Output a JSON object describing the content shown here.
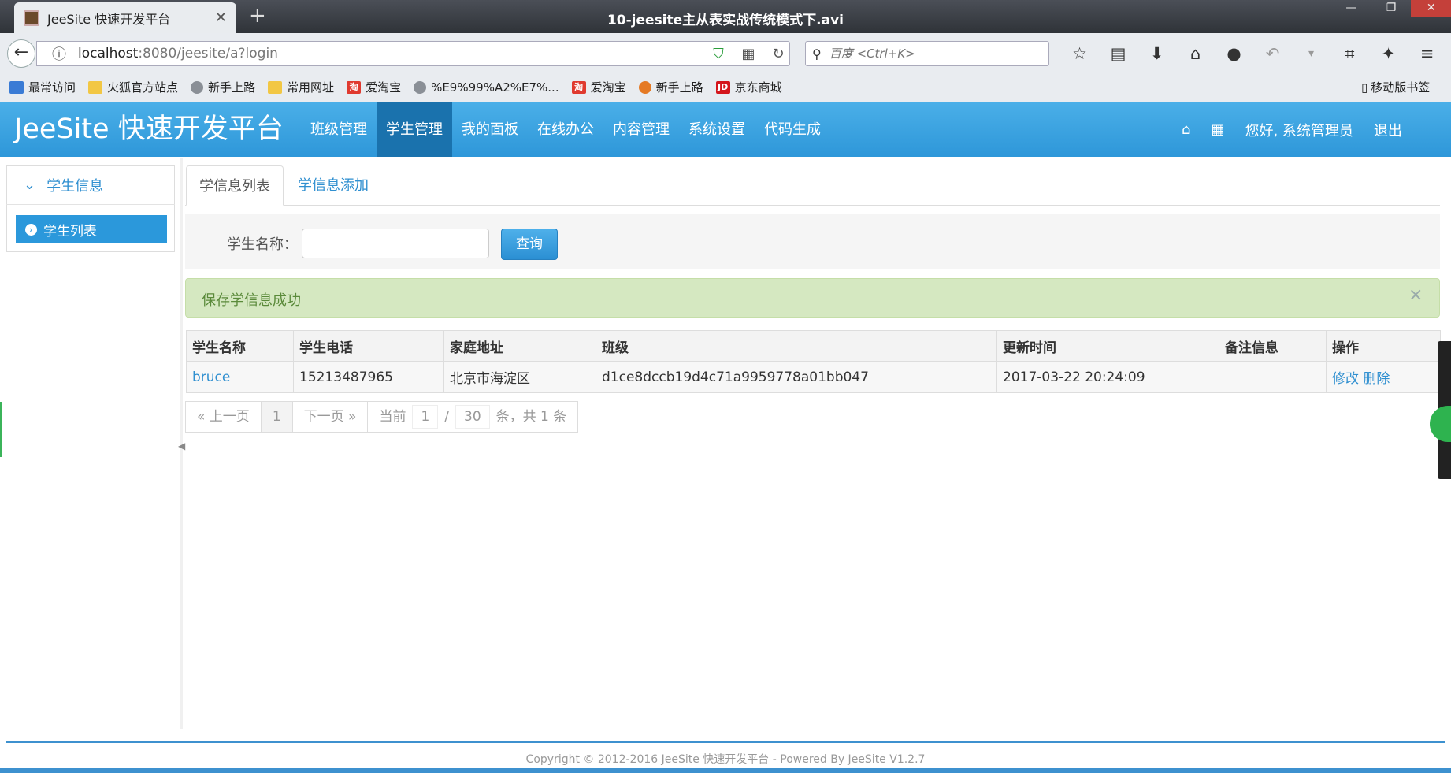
{
  "browser": {
    "tab_title": "JeeSite 快速开发平台",
    "tab_close": "✕",
    "new_tab": "+",
    "video_title": "10-jeesite主从表实战传统模式下.avi",
    "url_host": "localhost",
    "url_path": ":8080/jeesite/a?login",
    "search_placeholder": "百度 <Ctrl+K>",
    "win_min": "—",
    "win_restore": "❐",
    "win_close": "✕"
  },
  "bookmarks": {
    "items": [
      {
        "label": "最常访问",
        "icon": "most-visited-icon"
      },
      {
        "label": "火狐官方站点",
        "icon": "folder-icon"
      },
      {
        "label": "新手上路",
        "icon": "globe-icon"
      },
      {
        "label": "常用网址",
        "icon": "folder-icon"
      },
      {
        "label": "爱淘宝",
        "icon": "taobao-icon"
      },
      {
        "label": "%E9%99%A2%E7%...",
        "icon": "globe-icon"
      },
      {
        "label": "爱淘宝",
        "icon": "taobao-icon"
      },
      {
        "label": "新手上路",
        "icon": "firefox-icon"
      },
      {
        "label": "京东商城",
        "icon": "jd-icon"
      }
    ],
    "mobile": "移动版书签"
  },
  "app": {
    "brand": "JeeSite 快速开发平台",
    "nav": [
      "班级管理",
      "学生管理",
      "我的面板",
      "在线办公",
      "内容管理",
      "系统设置",
      "代码生成"
    ],
    "active_nav": "学生管理",
    "greeting": "您好, 系统管理员",
    "logout": "退出"
  },
  "sidebar": {
    "section": "学生信息",
    "items": [
      {
        "label": "学生列表",
        "active": true
      }
    ]
  },
  "tabs": {
    "list": "学信息列表",
    "add": "学信息添加"
  },
  "search": {
    "label": "学生名称：",
    "value": "",
    "button": "查询"
  },
  "alert": {
    "text": "保存学信息成功",
    "close": "×"
  },
  "table": {
    "headers": [
      "学生名称",
      "学生电话",
      "家庭地址",
      "班级",
      "更新时间",
      "备注信息",
      "操作"
    ],
    "rows": [
      {
        "name": "bruce",
        "phone": "15213487965",
        "address": "北京市海淀区",
        "class": "d1ce8dccb19d4c71a9959778a01bb047",
        "updated": "2017-03-22 20:24:09",
        "remarks": "",
        "edit": "修改",
        "delete": "删除"
      }
    ]
  },
  "pagination": {
    "prev": "« 上一页",
    "current": "1",
    "next": "下一页 »",
    "info_prefix": "当前",
    "page_no": "1",
    "slash": "/",
    "page_size": "30",
    "info_suffix": "条，共 1 条"
  },
  "footer": {
    "text": "Copyright © 2012-2016 JeeSite 快速开发平台 - Powered By JeeSite V1.2.7"
  },
  "colors": {
    "header": "#2e97d9",
    "active_nav": "#1a72ad",
    "link": "#2f8fd0",
    "alert_bg": "#d5e8c1"
  }
}
